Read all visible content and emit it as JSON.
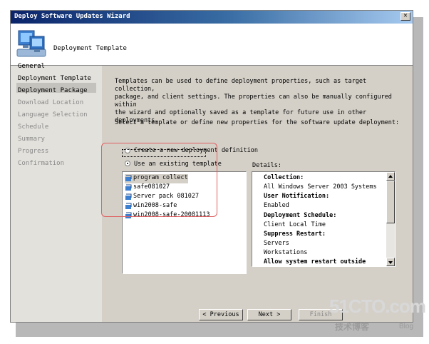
{
  "window": {
    "title": "Deploy Software Updates Wizard",
    "close_glyph": "✕"
  },
  "header": {
    "title": "Deployment Template",
    "icon": "computers-icon"
  },
  "sidebar": {
    "items": [
      {
        "label": "General",
        "state": "enabled"
      },
      {
        "label": "Deployment Template",
        "state": "active"
      },
      {
        "label": "Deployment Package",
        "state": "enabled"
      },
      {
        "label": "Download Location",
        "state": "disabled"
      },
      {
        "label": "Language Selection",
        "state": "disabled"
      },
      {
        "label": "Schedule",
        "state": "disabled"
      },
      {
        "label": "Summary",
        "state": "disabled"
      },
      {
        "label": "Progress",
        "state": "disabled"
      },
      {
        "label": "Confirmation",
        "state": "disabled"
      }
    ]
  },
  "main": {
    "description": "Templates can be used to define deployment properties, such as target collection,\npackage, and client settings. The properties can also be manually configured within\nthe wizard and optionally saved as a template for future use in other deployments.",
    "prompt": "Select a template or define new properties for the software update deployment:",
    "radio_create": {
      "label": "Create a new deployment definition",
      "checked": false
    },
    "radio_existing": {
      "label": "Use an existing template",
      "checked": true
    },
    "templates": [
      {
        "label": "program collect",
        "selected": true
      },
      {
        "label": "safe081027",
        "selected": false
      },
      {
        "label": "Server pack 081027",
        "selected": false
      },
      {
        "label": "win2008-safe",
        "selected": false
      },
      {
        "label": "win2008-safe-20081113",
        "selected": false
      }
    ],
    "details_label": "Details:",
    "details": [
      {
        "text": "Collection:",
        "bold": true
      },
      {
        "text": "All Windows Server 2003 Systems",
        "bold": false
      },
      {
        "text": "User Notification:",
        "bold": true
      },
      {
        "text": "Enabled",
        "bold": false
      },
      {
        "text": "Deployment Schedule:",
        "bold": true
      },
      {
        "text": "Client Local Time",
        "bold": false
      },
      {
        "text": "Suppress Restart:",
        "bold": true
      },
      {
        "text": "Servers",
        "bold": false
      },
      {
        "text": "Workstations",
        "bold": false
      },
      {
        "text": "Allow system restart outside",
        "bold": true
      }
    ]
  },
  "footer": {
    "previous_label": "< Previous",
    "next_label": "Next >",
    "finish_label": "Finish"
  },
  "watermark": {
    "site": "51CTO.com",
    "sub": "技术博客",
    "blog": "Blog"
  },
  "colors": {
    "titlebar_start": "#0a246a",
    "titlebar_end": "#a6caf0",
    "dialog_face": "#d4d0c8",
    "highlight_box": "#e06060"
  }
}
